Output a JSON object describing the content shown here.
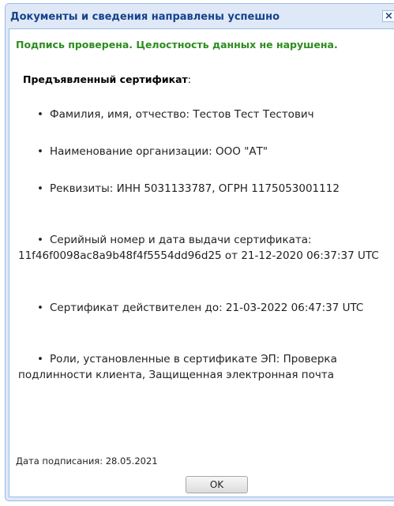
{
  "dialog": {
    "title": "Документы и сведения направлены успешно",
    "close_glyph": "×",
    "status": "Подпись проверена. Целостность данных не нарушена.",
    "cert_heading": "Предъявленный сертификат",
    "cert_heading_colon": ":",
    "items": [
      "Фамилия, имя, отчество: Тестов Тест Тестович",
      "Наименование организации: ООО \"АТ\"",
      "Реквизиты: ИНН 5031133787, ОГРН 1175053001112",
      "Серийный номер и дата выдачи сертификата: 11f46f0098ac8a9b48f4f5554dd96d25 от 21-12-2020 06:37:37 UTC",
      "Сертификат действителен до: 21-03-2022 06:47:37 UTC",
      "Роли, установленные в сертификате ЭП: Проверка подлинности клиента, Защищенная электронная почта"
    ],
    "bullet": "•",
    "sign_date": "Дата подписания: 28.05.2021",
    "ok_label": "OK"
  },
  "colors": {
    "frame": "#dfe8f6",
    "border": "#99bbe8",
    "title": "#15428b",
    "status": "#2c8d1f"
  },
  "icons": {
    "close": "close-icon",
    "bullet": "bullet-icon"
  }
}
